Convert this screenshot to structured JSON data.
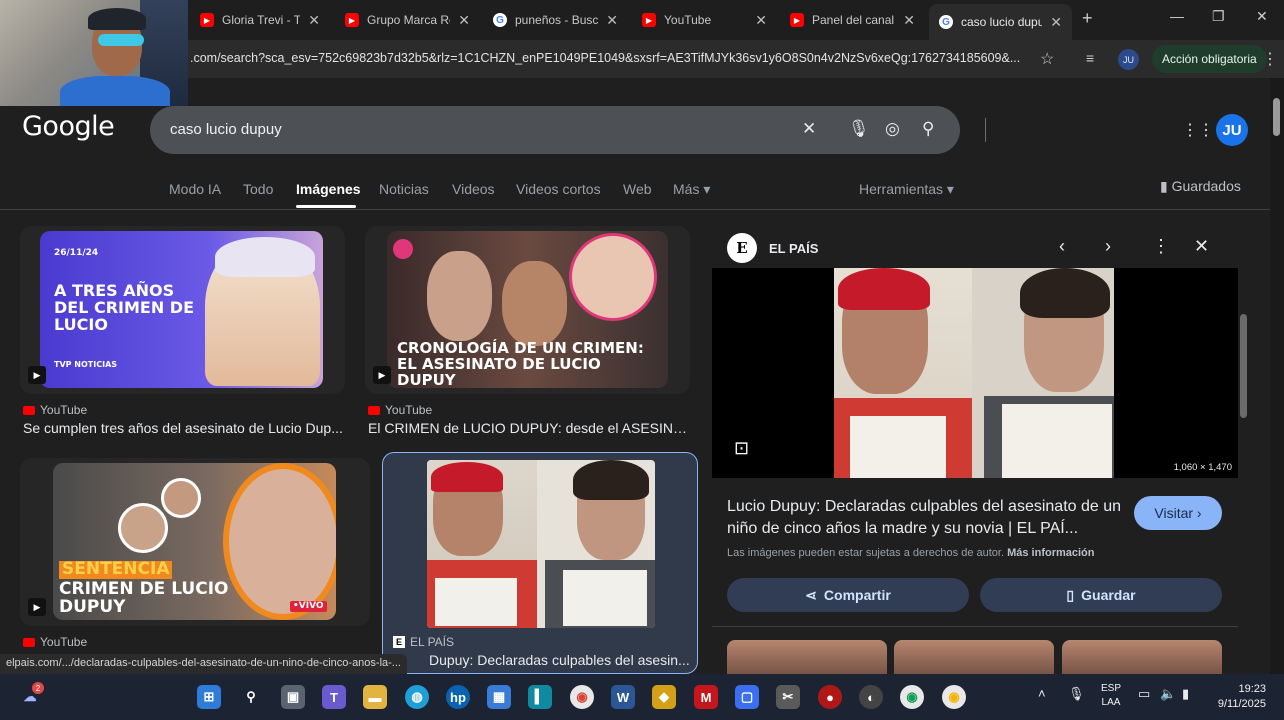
{
  "browser": {
    "tabs": [
      {
        "title": "Gloria Trevi - Toc",
        "icon": "youtube-icon"
      },
      {
        "title": "Grupo Marca Re",
        "icon": "youtube-icon"
      },
      {
        "title": "puneños - Busca",
        "icon": "google-icon"
      },
      {
        "title": "YouTube",
        "icon": "youtube-icon"
      },
      {
        "title": "Panel del canal",
        "icon": "youtube-icon"
      },
      {
        "title": "caso lucio dupuy",
        "icon": "google-icon",
        "active": true
      }
    ],
    "url": ".com/search?sca_esv=752c69823b7d32b5&rlz=1C1CHZN_enPE1049PE1049&sxsrf=AE3TifMJYk36sv1y6O8S0n4v2NzSv6xeQg:1762734185609&...",
    "profile_initials": "JU",
    "action_label": "Acción obligatoria"
  },
  "google": {
    "logo": "Google",
    "query": "caso lucio dupuy",
    "avatar": "JU",
    "nav": [
      "Modo IA",
      "Todo",
      "Imágenes",
      "Noticias",
      "Videos",
      "Videos cortos",
      "Web",
      "Más"
    ],
    "tools": "Herramientas",
    "saved": "Guardados"
  },
  "results": [
    {
      "source": "YouTube",
      "title": "Se cumplen tres años del asesinato de Lucio Dup...",
      "thumb": {
        "date": "26/11/24",
        "headline": "A TRES AÑOS DEL CRIMEN DE LUCIO",
        "brand": "TVP NOTICIAS"
      }
    },
    {
      "source": "YouTube",
      "title": "El CRIMEN de LUCIO DUPUY: desde el ASESINA...",
      "thumb": {
        "headline": "CRONOLOGÍA DE UN CRIMEN: EL ASESINATO DE LUCIO DUPUY"
      }
    },
    {
      "source": "YouTube",
      "title": "",
      "thumb": {
        "headline1": "SENTENCIA",
        "headline2": "CRIMEN DE LUCIO DUPUY",
        "live": "•VIVO"
      }
    },
    {
      "source": "EL PAÍS",
      "title": "Dupuy: Declaradas culpables del asesin...",
      "thumb": {}
    }
  ],
  "panel": {
    "source": "EL PAÍS",
    "source_initial": "E",
    "dimensions": "1,060 × 1,470",
    "title": "Lucio Dupuy: Declaradas culpables del asesinato de un niño de cinco años la madre y su novia | EL PAÍ...",
    "visit": "Visitar",
    "notice": "Las imágenes pueden estar sujetas a derechos de autor.",
    "notice_link": "Más información",
    "share": "Compartir",
    "save": "Guardar"
  },
  "status_url": "elpais.com/.../declaradas-culpables-del-asesinato-de-un-nino-de-cinco-anos-la-...",
  "taskbar": {
    "lang_top": "ESP",
    "lang_bottom": "LAA",
    "time": "19:23",
    "date": "9/11/2025",
    "badge": "2"
  }
}
